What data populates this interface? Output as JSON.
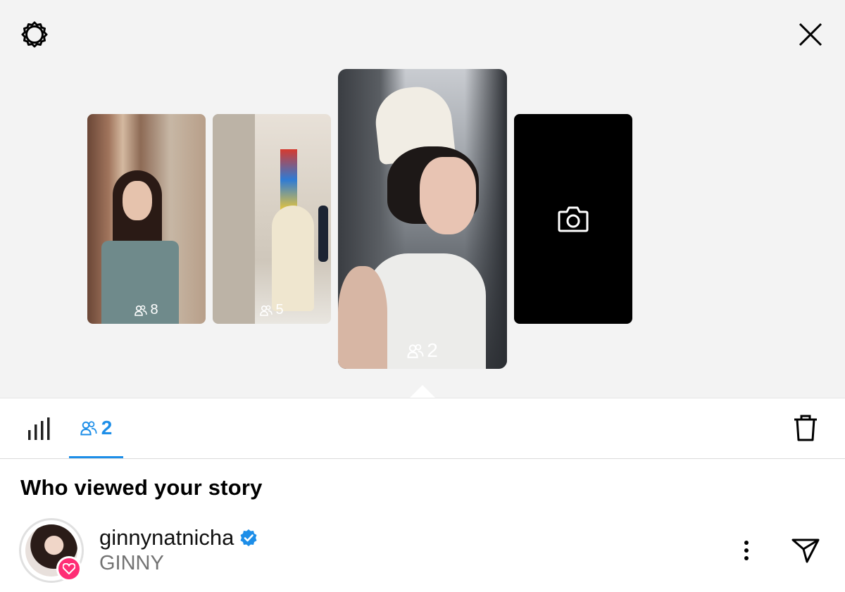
{
  "header": {
    "settings_icon": "gear-icon",
    "close_icon": "close-icon"
  },
  "stories": [
    {
      "viewers": "8"
    },
    {
      "viewers": "5"
    },
    {
      "viewers": "2"
    },
    {
      "type": "camera",
      "icon": "camera-icon"
    }
  ],
  "tabs": {
    "insights_icon": "bar-chart-icon",
    "viewers_icon": "people-icon",
    "viewers_count": "2",
    "delete_icon": "trash-icon"
  },
  "section": {
    "title": "Who viewed your story"
  },
  "viewers": [
    {
      "username": "ginnynatnicha",
      "verified": true,
      "full_name": "GINNY",
      "reaction": "heart-icon"
    }
  ],
  "colors": {
    "accent": "#1d8ee8",
    "verified": "#1d8ee8",
    "reaction": "#ff2d75",
    "top_background": "#f3f3f3"
  }
}
